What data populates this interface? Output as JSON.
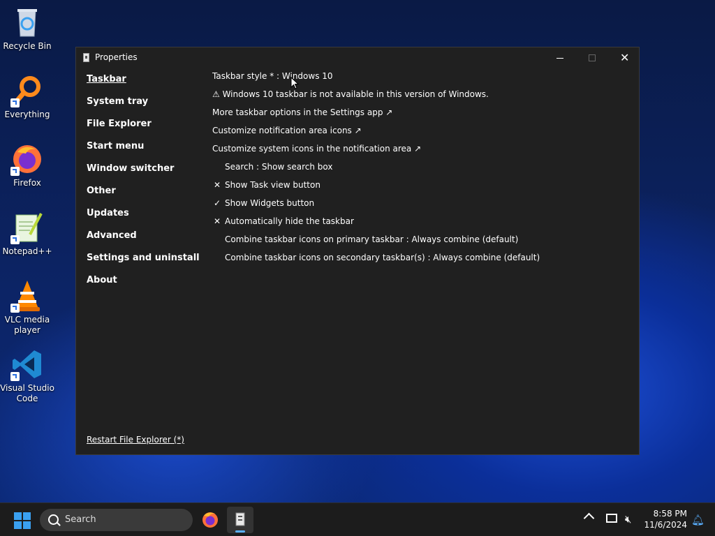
{
  "desktop": {
    "icons": [
      {
        "label": "Recycle Bin",
        "icon": "recycle-bin-icon"
      },
      {
        "label": "Everything",
        "icon": "everything-icon"
      },
      {
        "label": "Firefox",
        "icon": "firefox-icon"
      },
      {
        "label": "Notepad++",
        "icon": "notepadpp-icon"
      },
      {
        "label": "VLC media player",
        "icon": "vlc-icon"
      },
      {
        "label": "Visual Studio Code",
        "icon": "vscode-icon"
      }
    ]
  },
  "window": {
    "title": "Properties",
    "nav": [
      {
        "label": "Taskbar",
        "active": true
      },
      {
        "label": "System tray"
      },
      {
        "label": "File Explorer"
      },
      {
        "label": "Start menu"
      },
      {
        "label": "Window switcher"
      },
      {
        "label": "Other"
      },
      {
        "label": "Updates"
      },
      {
        "label": "Advanced"
      },
      {
        "label": "Settings and uninstall"
      },
      {
        "label": "About"
      }
    ],
    "restart_label": "Restart File Explorer (*)",
    "content": [
      {
        "text": "Taskbar style * : Windows 10",
        "mark": "",
        "indent": false
      },
      {
        "text": "⚠ Windows 10 taskbar is not available in this version of Windows.",
        "mark": "",
        "indent": false
      },
      {
        "text": "More taskbar options in the Settings app ↗",
        "mark": "",
        "indent": false
      },
      {
        "text": "Customize notification area icons ↗",
        "mark": "",
        "indent": false
      },
      {
        "text": "Customize system icons in the notification area ↗",
        "mark": "",
        "indent": false
      },
      {
        "text": "Search : Show search box",
        "mark": "",
        "indent": true
      },
      {
        "text": "Show Task view button",
        "mark": "✕",
        "indent": true
      },
      {
        "text": "Show Widgets button",
        "mark": "✓",
        "indent": true
      },
      {
        "text": "Automatically hide the taskbar",
        "mark": "✕",
        "indent": true
      },
      {
        "text": "Combine taskbar icons on primary taskbar : Always combine (default)",
        "mark": "",
        "indent": true
      },
      {
        "text": "Combine taskbar icons on secondary taskbar(s) : Always combine (default)",
        "mark": "",
        "indent": true
      }
    ]
  },
  "taskbar": {
    "search_placeholder": "Search",
    "time": "8:58 PM",
    "date": "11/6/2024"
  },
  "colors": {
    "window_bg": "#202020",
    "taskbar_bg": "#1c1c1c",
    "accent": "#3aa0f0"
  }
}
